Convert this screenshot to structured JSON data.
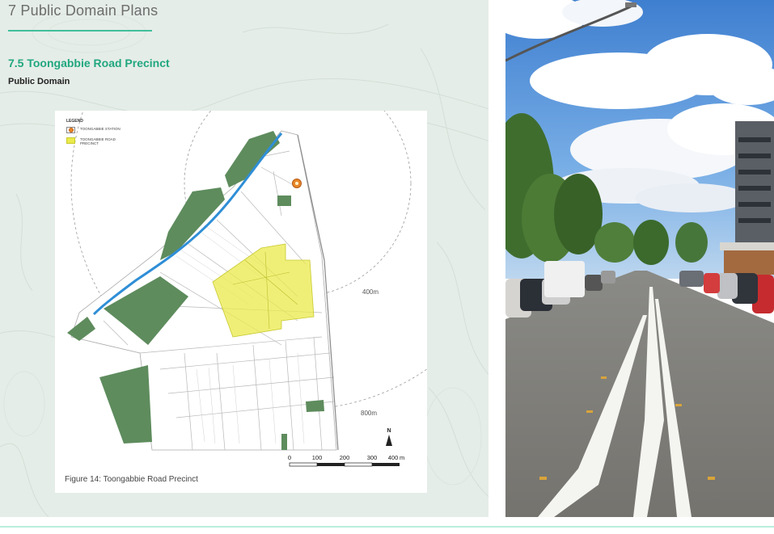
{
  "section": {
    "title": "7 Public Domain Plans"
  },
  "subsection": {
    "title": "7.5 Toongabbie Road Precinct",
    "heading": "Public Domain"
  },
  "figure": {
    "caption": "Figure 14: Toongabbie Road Precinct",
    "legend": {
      "title": "LEGEND",
      "items": [
        {
          "label": "TOONGABBIE STATION",
          "color": "#e8862a"
        },
        {
          "label": "TOONGABBIE ROAD PRECINCT",
          "color": "#eaea4b"
        }
      ]
    },
    "rings": [
      "400m",
      "800m"
    ],
    "scale": {
      "ticks": [
        "0",
        "100",
        "200",
        "300",
        "400"
      ],
      "units": "m"
    },
    "north": "N"
  },
  "colors": {
    "accent": "#21a77f",
    "rule": "#3fbf9a",
    "park": "#5e8c5d",
    "creek": "#2f8ed6",
    "precinct": "#eaea4b",
    "background": "#e5ede8"
  },
  "icons": [
    "station-marker-icon",
    "north-arrow-icon"
  ]
}
